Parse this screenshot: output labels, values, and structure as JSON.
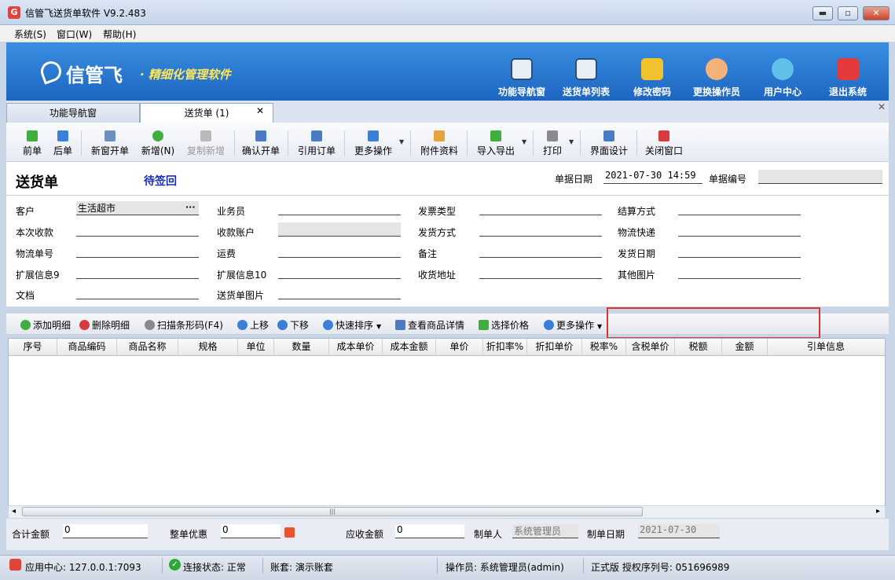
{
  "window": {
    "title": "信管飞送货单软件 V9.2.483",
    "min": "▬",
    "max": "▫",
    "close": "✕"
  },
  "menu": [
    {
      "label": "系统(S)"
    },
    {
      "label": "窗口(W)"
    },
    {
      "label": "帮助(H)"
    }
  ],
  "banner": {
    "logo": "信管飞",
    "slogan": "· 精细化管理软件",
    "buttons": [
      {
        "label": "功能导航窗",
        "icon": "monitor-icon",
        "color": "#e8eef5"
      },
      {
        "label": "送货单列表",
        "icon": "list-icon",
        "color": "#e8eef5"
      },
      {
        "label": "修改密码",
        "icon": "lock-icon",
        "color": "#f2c12e"
      },
      {
        "label": "更换操作员",
        "icon": "user-icon",
        "color": "#f3b27a"
      },
      {
        "label": "用户中心",
        "icon": "globe-icon",
        "color": "#5fc1ea"
      },
      {
        "label": "退出系统",
        "icon": "power-icon",
        "color": "#e33b3b"
      }
    ]
  },
  "tabs": [
    {
      "label": "功能导航窗"
    },
    {
      "label": "送货单 (1)",
      "close": "✕"
    }
  ],
  "panel_close": "✕",
  "toolbar": [
    {
      "label": "前单",
      "icon": "arrow-left-icon",
      "color": "#3fae3f"
    },
    {
      "label": "后单",
      "icon": "arrow-right-icon",
      "color": "#3a7fd8"
    },
    {
      "label": "新窗开单",
      "icon": "new-window-icon",
      "color": "#6a8fc2"
    },
    {
      "label": "新增(N)",
      "icon": "add-icon",
      "color": "#3fae3f"
    },
    {
      "label": "复制新增",
      "icon": "copy-icon",
      "color": "#b9b9b9"
    },
    {
      "label": "确认开单",
      "icon": "save-icon",
      "color": "#4a7cc4"
    },
    {
      "label": "引用订单",
      "icon": "reference-icon",
      "color": "#4a7cc4"
    },
    {
      "label": "更多操作",
      "icon": "more-icon",
      "color": "#3a7fd8"
    },
    {
      "label": "附件资料",
      "icon": "attachment-icon",
      "color": "#e8a23c"
    },
    {
      "label": "导入导出",
      "icon": "import-export-icon",
      "color": "#3fae3f"
    },
    {
      "label": "打印",
      "icon": "print-icon",
      "color": "#8a8a8a"
    },
    {
      "label": "界面设计",
      "icon": "design-icon",
      "color": "#4a7cc4"
    },
    {
      "label": "关闭窗口",
      "icon": "close-window-icon",
      "color": "#d83b3b"
    }
  ],
  "form": {
    "title": "送货单",
    "status": "待签回",
    "date_label": "单据日期",
    "date_value": "2021-07-30 14:59",
    "number_label": "单据编号",
    "number_value": "",
    "fields": [
      {
        "label": "客户",
        "value": "生活超市"
      },
      {
        "label": "业务员",
        "value": ""
      },
      {
        "label": "发票类型",
        "value": ""
      },
      {
        "label": "结算方式",
        "value": ""
      },
      {
        "label": "本次收款",
        "value": ""
      },
      {
        "label": "收款账户",
        "value": ""
      },
      {
        "label": "发货方式",
        "value": ""
      },
      {
        "label": "物流快递",
        "value": ""
      },
      {
        "label": "物流单号",
        "value": ""
      },
      {
        "label": "运费",
        "value": ""
      },
      {
        "label": "备注",
        "value": ""
      },
      {
        "label": "发货日期",
        "value": ""
      },
      {
        "label": "扩展信息9",
        "value": ""
      },
      {
        "label": "扩展信息10",
        "value": ""
      },
      {
        "label": "收货地址",
        "value": ""
      },
      {
        "label": "其他图片",
        "value": ""
      },
      {
        "label": "文档",
        "value": ""
      },
      {
        "label": "送货单图片",
        "value": ""
      }
    ],
    "customer_btn": "···"
  },
  "detail_toolbar": [
    {
      "label": "添加明细",
      "icon": "add-icon",
      "color": "#3fae3f"
    },
    {
      "label": "删除明细",
      "icon": "delete-icon",
      "color": "#d83b3b"
    },
    {
      "label": "扫描条形码(F4)",
      "icon": "barcode-icon",
      "color": "#8a8a8a"
    },
    {
      "label": "上移",
      "icon": "arrow-up-icon",
      "color": "#3a7fd8"
    },
    {
      "label": "下移",
      "icon": "arrow-down-icon",
      "color": "#3a7fd8"
    },
    {
      "label": "快速排序",
      "icon": "sort-icon",
      "color": "#3a7fd8"
    },
    {
      "label": "查看商品详情",
      "icon": "detail-icon",
      "color": "#4a7cc4"
    },
    {
      "label": "选择价格",
      "icon": "price-icon",
      "color": "#3fae3f"
    },
    {
      "label": "更多操作",
      "icon": "more-icon",
      "color": "#3a7fd8"
    }
  ],
  "grid": {
    "columns": [
      "序号",
      "商品编码",
      "商品名称",
      "规格",
      "单位",
      "数量",
      "成本单价",
      "成本金额",
      "单价",
      "折扣率%",
      "折扣单价",
      "税率%",
      "含税单价",
      "税额",
      "金额",
      "引单信息"
    ],
    "scroll_left": "◂",
    "scroll_right": "▸",
    "thumb": "|||"
  },
  "footer": {
    "total_label": "合计金额",
    "total_value": "0",
    "discount_label": "整单优惠",
    "discount_value": "0",
    "receivable_label": "应收金额",
    "receivable_value": "0",
    "maker_label": "制单人",
    "maker_value": "系统管理员",
    "make_date_label": "制单日期",
    "make_date_value": "2021-07-30"
  },
  "status": {
    "app_center": "应用中心: 127.0.0.1:7093",
    "connection": "连接状态: 正常",
    "account": "账套: 演示账套",
    "operator": "操作员: 系统管理员(admin)",
    "license": "正式版 授权序列号: 051696989"
  }
}
